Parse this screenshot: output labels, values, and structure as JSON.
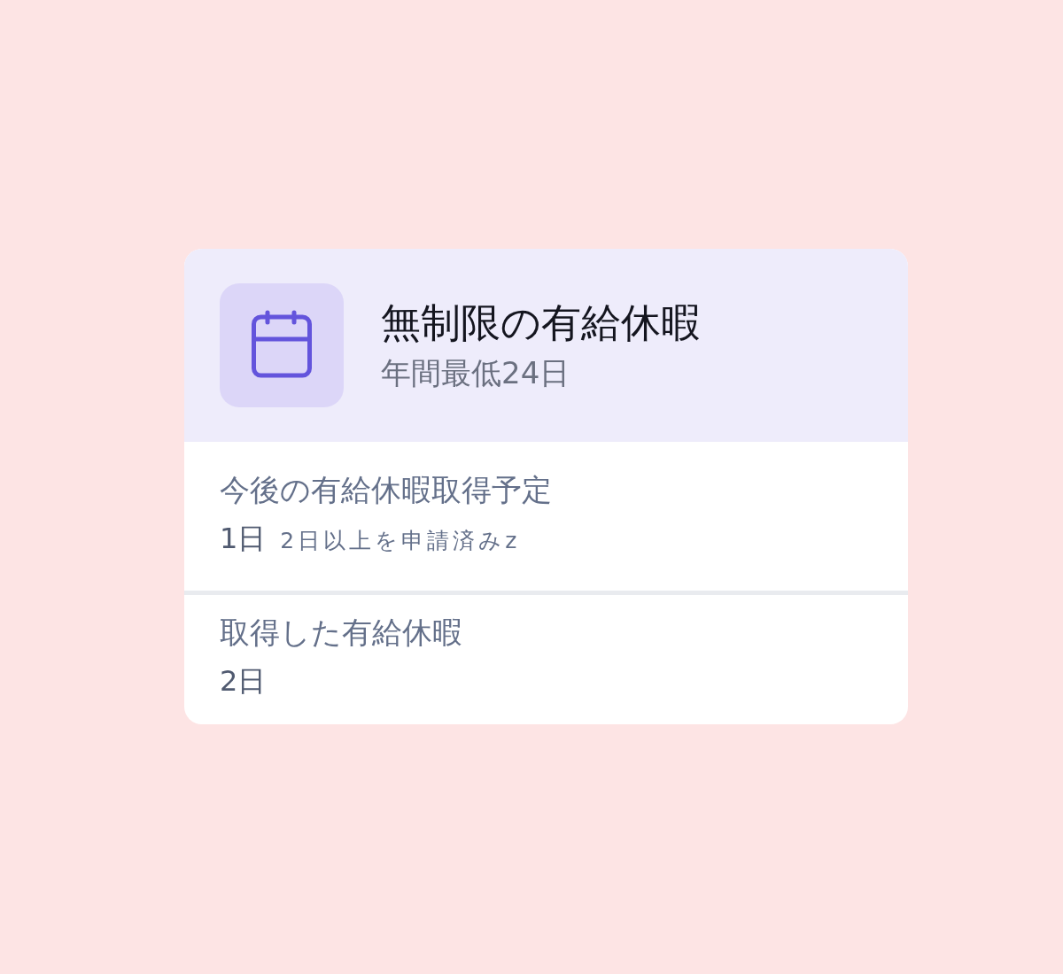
{
  "card": {
    "title": "無制限の有給休暇",
    "subtitle": "年間最低24日"
  },
  "sections": [
    {
      "label": "今後の有給休暇取得予定",
      "value": "1日",
      "note": "2日以上を申請済みz"
    },
    {
      "label": "取得した有給休暇",
      "value": "2日"
    }
  ]
}
